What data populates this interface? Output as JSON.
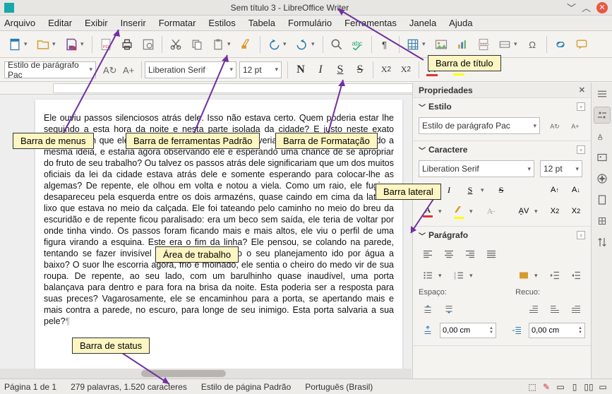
{
  "titlebar": {
    "title": "Sem título 3 - LibreOffice Writer"
  },
  "menus": [
    "Arquivo",
    "Editar",
    "Exibir",
    "Inserir",
    "Formatar",
    "Estilos",
    "Tabela",
    "Formulário",
    "Ferramentas",
    "Janela",
    "Ajuda"
  ],
  "format": {
    "para_style": "Estilo de parágrafo Pac",
    "font_name": "Liberation Serif",
    "font_size": "12 pt"
  },
  "document_text": "Ele ouviu passos silenciosos atrás dele. Isso não estava certo. Quem poderia estar lhe seguindo a esta hora da noite e nesta parte isolada da cidade? E justo neste exato momento em que ele iria dar o seu grande golpe. Haveria outro safado que teria tido a mesma idéia, e estaria agora observando ele e esperando uma chance de se apropriar do fruto de seu trabalho? Ou talvez os passos atrás dele significariam que um dos muitos oficiais da lei da cidade estava atrás dele e somente esperando para colocar-lhe as algemas? De repente, ele olhou em volta e notou a viela. Como um raio, ele fugiu e desapareceu pela esquerda entre os dois armazéns, quase caindo em cima da lata de lixo que estava no meio da calçada. Ele foi tateando pelo caminho no meio do breu da escuridão e de repente ficou paralisado: era um beco sem saída, ele teria de voltar por onde tinha vindo. Os passos foram ficando mais e mais altos, ele viu o perfil de uma figura virando a esquina. Este era o fim da linha? Ele pensou, se colando na parede, tentando se fazer invisível no escuro, teria todo o seu planejamento ido por água a baixo? O suor lhe escorria agora, frio e molhado, ele sentia o cheiro do medo vir de sua roupa. De repente, ao seu lado, com um barulhinho quase inaudível, uma porta balançava para dentro e para fora na brisa da noite. Esta poderia ser a resposta para suas preces? Vagarosamente, ele se encaminhou para a porta, se apertando mais e mais contra a parede, no escuro, para longe de seu inimigo. Esta porta salvaria a sua pele?",
  "sidebar": {
    "title": "Propriedades",
    "sections": {
      "style": {
        "title": "Estilo",
        "value": "Estilo de parágrafo Pac"
      },
      "char": {
        "title": "Caractere",
        "font": "Liberation Serif",
        "size": "12 pt"
      },
      "para": {
        "title": "Parágrafo",
        "spacing_label": "Espaço:",
        "indent_label": "Recuo:",
        "spin1": "0,00 cm",
        "spin2": "0,00 cm"
      }
    }
  },
  "status": {
    "page": "Página 1 de 1",
    "words": "279 palavras, 1.520 caracteres",
    "style": "Estilo de página Padrão",
    "lang": "Português (Brasil)"
  },
  "callouts": {
    "title": "Barra de título",
    "menus": "Barra de menus",
    "std_toolbar": "Barra de ferramentas Padrão",
    "fmt_toolbar": "Barra de Formatação",
    "sidebar": "Barra lateral",
    "work": "Área de trabalho",
    "status": "Barra de status"
  }
}
